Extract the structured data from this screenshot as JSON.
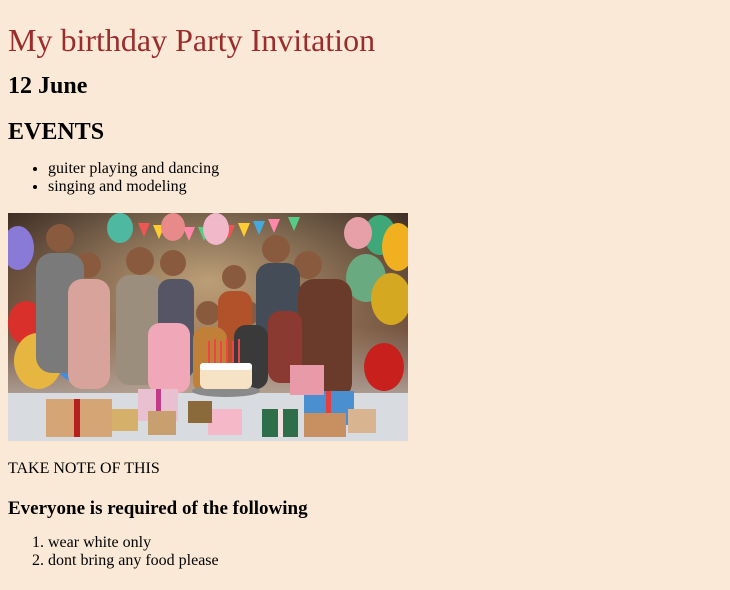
{
  "title": "My birthday Party Invitation",
  "date": "12 June",
  "events_heading": "EVENTS",
  "events": [
    "guiter playing and dancing",
    "singing and modeling"
  ],
  "image": {
    "icon": "party-photo"
  },
  "note": "TAKE NOTE OF THIS",
  "requirements_heading": "Everyone is required of the following",
  "requirements": [
    "wear white only",
    "dont bring any food please"
  ],
  "colors": {
    "background": "#fae9d6",
    "title": "#9b2c2c"
  }
}
